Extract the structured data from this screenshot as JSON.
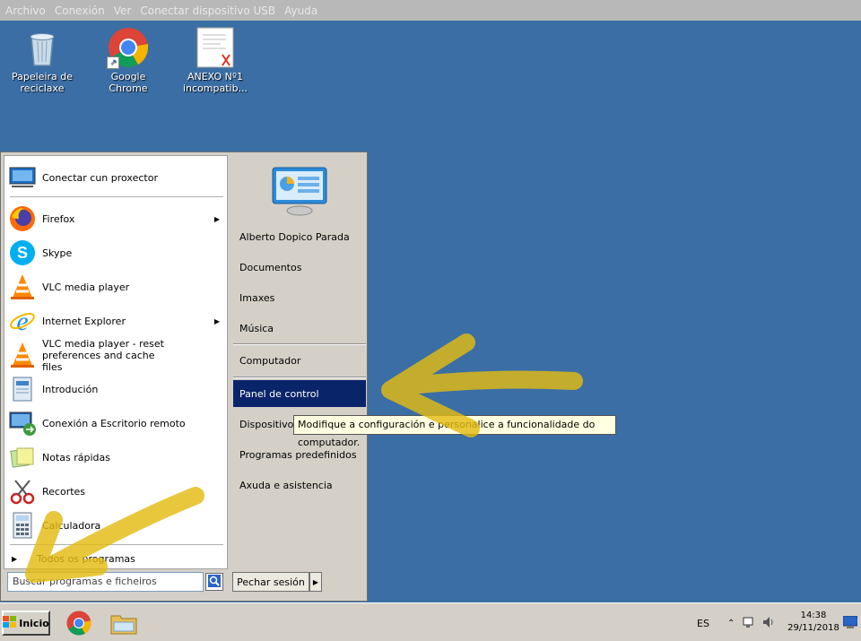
{
  "viewer_menu": [
    "Archivo",
    "Conexión",
    "Ver",
    "Conectar dispositivo USB",
    "Ayuda"
  ],
  "desktop_icons": [
    {
      "label": "Papeleira de reciclaxe",
      "icon": "recycle-bin-icon"
    },
    {
      "label": "Google Chrome",
      "icon": "chrome-icon"
    },
    {
      "label": "ANEXO Nº1 incompatib...",
      "icon": "pdf-document-icon"
    }
  ],
  "start_menu": {
    "left_items": [
      {
        "label": "Conectar cun proxector",
        "icon": "projector-icon",
        "submenu": false
      },
      {
        "label": "Firefox",
        "icon": "firefox-icon",
        "submenu": true
      },
      {
        "label": "Skype",
        "icon": "skype-icon",
        "submenu": false
      },
      {
        "label": "VLC media player",
        "icon": "vlc-icon",
        "submenu": false
      },
      {
        "label": "Internet Explorer",
        "icon": "internet-explorer-icon",
        "submenu": true
      },
      {
        "label": "VLC media player - reset preferences and cache files",
        "icon": "vlc-icon",
        "submenu": false
      },
      {
        "label": "Introdución",
        "icon": "getting-started-icon",
        "submenu": false
      },
      {
        "label": "Conexión a Escritorio remoto",
        "icon": "remote-desktop-icon",
        "submenu": false
      },
      {
        "label": "Notas rápidas",
        "icon": "sticky-notes-icon",
        "submenu": false
      },
      {
        "label": "Recortes",
        "icon": "snipping-tool-icon",
        "submenu": false
      },
      {
        "label": "Calculadora",
        "icon": "calculator-icon",
        "submenu": false
      }
    ],
    "all_programs": "Todos os programas",
    "search_placeholder": "Buscar programas e ficheiros",
    "right_items": [
      {
        "label": "Alberto Dopico Parada"
      },
      {
        "label": "Documentos"
      },
      {
        "label": "Imaxes"
      },
      {
        "label": "Música"
      },
      {
        "label": "Computador"
      },
      {
        "label": "Panel de control"
      },
      {
        "label": "Dispositivos"
      },
      {
        "label": "Programas predefinidos"
      },
      {
        "label": "Axuda e asistencia"
      }
    ],
    "logoff_label": "Pechar sesión",
    "tooltip": "Modifique a configuración e personalice a funcionalidade do computador."
  },
  "taskbar": {
    "start_label": "Inicio",
    "pinned": [
      "chrome-icon",
      "explorer-folder-icon"
    ],
    "language": "ES",
    "time": "14:38",
    "date": "29/11/2018"
  },
  "colors": {
    "desktop": "#3a6ea5",
    "highlight": "#0a246a",
    "annotation": "#e8c41a"
  }
}
